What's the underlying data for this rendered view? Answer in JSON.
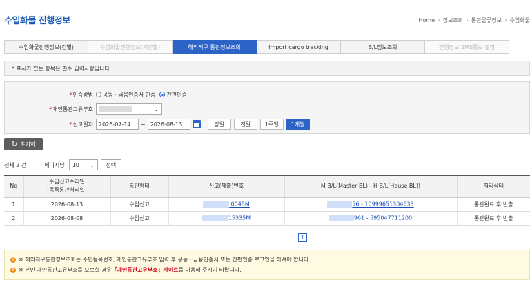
{
  "header": {
    "title": "수입화물 진행정보",
    "breadcrumb": [
      "Home",
      "정보조회",
      "통관물류정보",
      "수입화물"
    ]
  },
  "tabs": [
    {
      "label": "수입화물진행정보(건별)",
      "state": "normal"
    },
    {
      "label": "수입화물진행정보(기간별)",
      "state": "disabled"
    },
    {
      "label": "해외직구 통관정보조회",
      "state": "active"
    },
    {
      "label": "Import cargo tracking",
      "state": "normal"
    },
    {
      "label": "B/L정보조회",
      "state": "normal"
    },
    {
      "label": "진행정보 SMS통보 설정",
      "state": "disabled"
    }
  ],
  "notice": "* 표시가 있는 항목은 필수 입력사항입니다.",
  "form": {
    "auth": {
      "label": "인증방법",
      "options": [
        {
          "label": "공동 · 금융인증서 인증",
          "checked": false
        },
        {
          "label": "간편인증",
          "checked": true
        }
      ]
    },
    "customs_code": {
      "label": "개인통관고유부호"
    },
    "report_date": {
      "label": "신고일자",
      "from": "2026-07-14",
      "tilde": "~",
      "to": "2026-08-13",
      "periods": [
        {
          "label": "당일",
          "active": false
        },
        {
          "label": "전일",
          "active": false
        },
        {
          "label": "1주일",
          "active": false
        },
        {
          "label": "1개월",
          "active": true
        }
      ]
    }
  },
  "reset_label": "초기화",
  "summary": {
    "total": "전체 2 건",
    "per_page_label": "페이지당",
    "per_page_value": "10",
    "select_label": "선택"
  },
  "table": {
    "headers": [
      "No",
      "수입신고수리일\n(목록통관처리일)",
      "통관형태",
      "신고(제출)번호",
      "M B/L(Master BL) - H B/L(House BL))",
      "처리상태"
    ],
    "rows": [
      {
        "no": "1",
        "date": "2026-08-13",
        "type": "수입신고",
        "report_no": "I0045M",
        "bl": "56 - 10999651304633",
        "status": "통관완료 후 반출"
      },
      {
        "no": "2",
        "date": "2026-08-08",
        "type": "수입신고",
        "report_no": "15335M",
        "bl": "961 - 595047711200",
        "status": "통관완료 후 반출"
      }
    ]
  },
  "pagination": {
    "current": "1"
  },
  "alert": {
    "line1": "※ 해외직구통관정보조회는 주민등록번호, 개인통관고유부호 입력 후 공동 · 금융인증서 또는 간편인증 로그인을 하셔야 합니다.",
    "line2_pre": "※ 본인 개인통관고유부호를 모르실 경우 ",
    "line2_link": "「개인통관고유부호」사이트",
    "line2_post": "를 이용해 주시기 바랍니다."
  },
  "colors": {
    "accent": "#2b63c6",
    "title": "#1a5bb8",
    "required": "#d0021b",
    "warning": "#f08a1c"
  }
}
